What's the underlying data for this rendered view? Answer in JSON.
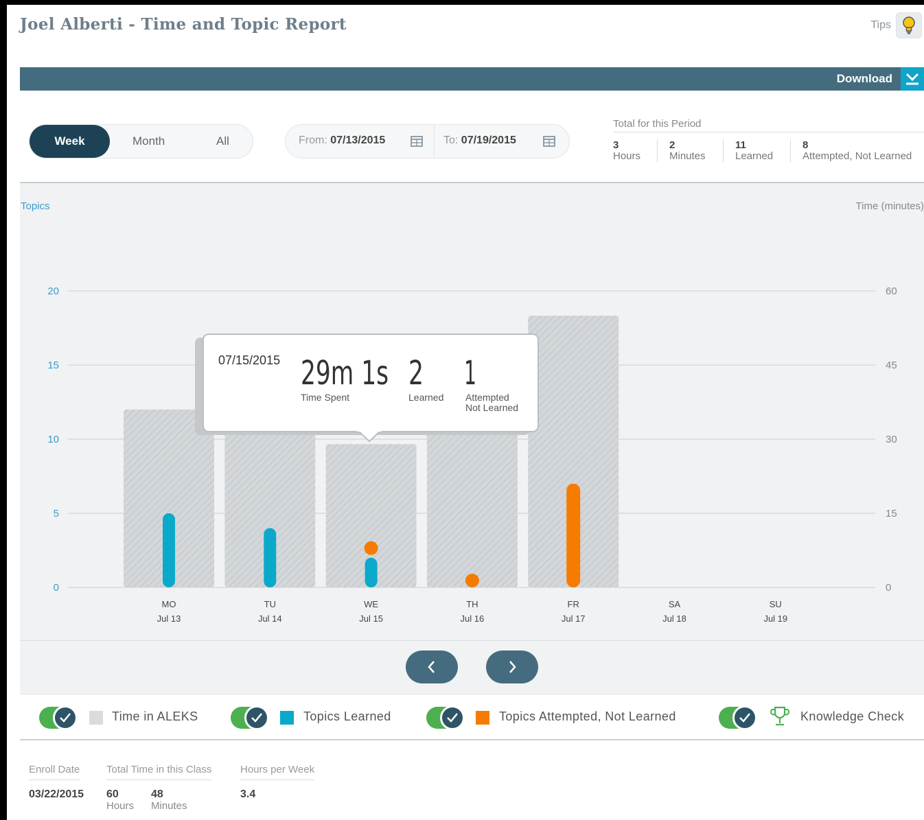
{
  "header": {
    "title": "Joel Alberti - Time and Topic Report",
    "tips_label": "Tips",
    "download_label": "Download"
  },
  "period": {
    "tabs": [
      "Week",
      "Month",
      "All"
    ],
    "selected": "Week"
  },
  "dates": {
    "from_label": "From:",
    "from_value": "07/13/2015",
    "to_label": "To:",
    "to_value": "07/19/2015"
  },
  "totals": {
    "heading": "Total for this Period",
    "items": [
      {
        "value": "3",
        "label": "Hours"
      },
      {
        "value": "2",
        "label": "Minutes"
      },
      {
        "value": "11",
        "label": "Learned"
      },
      {
        "value": "8",
        "label": "Attempted, Not Learned"
      }
    ]
  },
  "chart_data": {
    "type": "bar",
    "ylabel": "Topics",
    "y2label": "Time (minutes)",
    "ylim": [
      0,
      20
    ],
    "y2lim": [
      0,
      60
    ],
    "yticks": [
      "0",
      "5",
      "10",
      "15",
      "20"
    ],
    "y2ticks": [
      "0",
      "15",
      "30",
      "45",
      "60"
    ],
    "categories": [
      {
        "day": "MO",
        "date": "Jul 13"
      },
      {
        "day": "TU",
        "date": "Jul 14"
      },
      {
        "day": "WE",
        "date": "Jul 15"
      },
      {
        "day": "TH",
        "date": "Jul 16"
      },
      {
        "day": "FR",
        "date": "Jul 17"
      },
      {
        "day": "SA",
        "date": "Jul 18"
      },
      {
        "day": "SU",
        "date": "Jul 19"
      }
    ],
    "series": [
      {
        "name": "Time in ALEKS",
        "axis": "right",
        "color": "#cfd3d6",
        "values": [
          36,
          36,
          29,
          36,
          55,
          0,
          0
        ]
      },
      {
        "name": "Topics Learned",
        "axis": "left",
        "color": "#0ba9c9",
        "values": [
          5,
          4,
          2,
          0,
          0,
          0,
          0
        ]
      },
      {
        "name": "Topics Attempted, Not Learned",
        "axis": "left",
        "color": "#f57c00",
        "values": [
          0,
          0,
          1,
          1,
          7,
          0,
          0
        ]
      }
    ],
    "tooltip": {
      "date": "07/15/2015",
      "time_value": "29m 1s",
      "time_label": "Time Spent",
      "learned_value": "2",
      "learned_label": "Learned",
      "attempted_value": "1",
      "attempted_label_1": "Attempted",
      "attempted_label_2": "Not Learned"
    }
  },
  "legend": [
    {
      "label": "Time in ALEKS",
      "color": "#d9dcde",
      "icon": "square"
    },
    {
      "label": "Topics Learned",
      "color": "#0ba9c9",
      "icon": "square"
    },
    {
      "label": "Topics Attempted, Not Learned",
      "color": "#f57c00",
      "icon": "square"
    },
    {
      "label": "Knowledge Check",
      "color": "#4caf50",
      "icon": "trophy-icon"
    }
  ],
  "stats": {
    "enroll_label": "Enroll Date",
    "enroll_value": "03/22/2015",
    "total_label": "Total Time in this Class",
    "total_hours": "60",
    "total_hours_unit": "Hours",
    "total_minutes": "48",
    "total_minutes_unit": "Minutes",
    "hpw_label": "Hours per Week",
    "hpw_value": "3.4"
  }
}
